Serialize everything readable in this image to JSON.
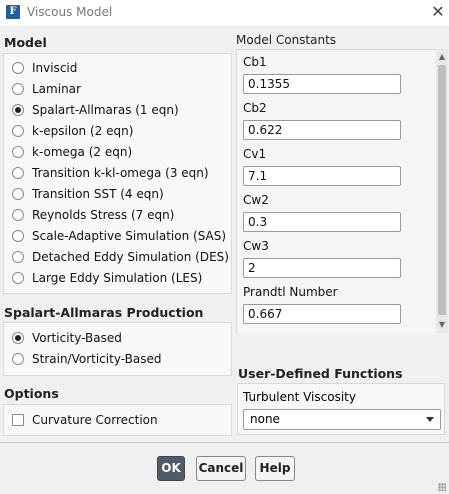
{
  "window": {
    "title": "Viscous Model",
    "app_icon": "F"
  },
  "model": {
    "heading": "Model",
    "options": [
      {
        "label": "Inviscid",
        "selected": false
      },
      {
        "label": "Laminar",
        "selected": false
      },
      {
        "label": "Spalart-Allmaras (1 eqn)",
        "selected": true
      },
      {
        "label": "k-epsilon (2 eqn)",
        "selected": false
      },
      {
        "label": "k-omega (2 eqn)",
        "selected": false
      },
      {
        "label": "Transition k-kl-omega (3 eqn)",
        "selected": false
      },
      {
        "label": "Transition SST (4 eqn)",
        "selected": false
      },
      {
        "label": "Reynolds Stress (7 eqn)",
        "selected": false
      },
      {
        "label": "Scale-Adaptive Simulation (SAS)",
        "selected": false
      },
      {
        "label": "Detached Eddy Simulation (DES)",
        "selected": false
      },
      {
        "label": "Large Eddy Simulation (LES)",
        "selected": false
      }
    ]
  },
  "production": {
    "heading": "Spalart-Allmaras Production",
    "options": [
      {
        "label": "Vorticity-Based",
        "selected": true
      },
      {
        "label": "Strain/Vorticity-Based",
        "selected": false
      }
    ]
  },
  "options": {
    "heading": "Options",
    "curvature_label": "Curvature Correction",
    "curvature_checked": false
  },
  "constants": {
    "heading": "Model Constants",
    "items": [
      {
        "label": "Cb1",
        "value": "0.1355"
      },
      {
        "label": "Cb2",
        "value": "0.622"
      },
      {
        "label": "Cv1",
        "value": "7.1"
      },
      {
        "label": "Cw2",
        "value": "0.3"
      },
      {
        "label": "Cw3",
        "value": "2"
      },
      {
        "label": "Prandtl Number",
        "value": "0.667"
      }
    ]
  },
  "udf": {
    "heading": "User-Defined Functions",
    "turbulent_viscosity_label": "Turbulent Viscosity",
    "turbulent_viscosity_value": "none"
  },
  "buttons": {
    "ok": "OK",
    "cancel": "Cancel",
    "help": "Help"
  },
  "colors": {
    "primary_button": "#4f5b66",
    "app_icon": "#1f5fa0"
  }
}
